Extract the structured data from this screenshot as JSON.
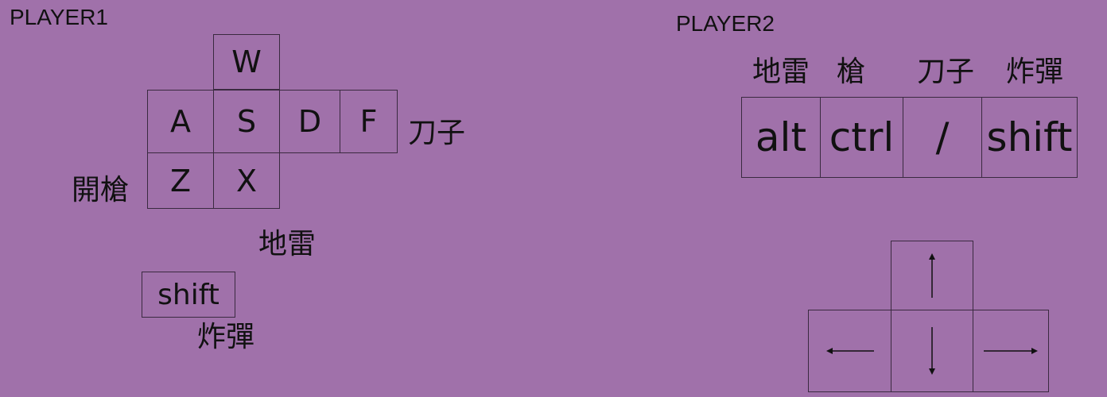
{
  "player1": {
    "title": "PLAYER1",
    "keys": {
      "up": "W",
      "left": "A",
      "down": "S",
      "right": "D",
      "fire2": "F",
      "fire": "Z",
      "mine": "X",
      "bomb": "shift"
    },
    "labels": {
      "knife": "刀子",
      "shoot": "開槍",
      "mine": "地雷",
      "bomb": "炸彈"
    }
  },
  "player2": {
    "title": "PLAYER2",
    "keys": {
      "mine": "alt",
      "shoot": "ctrl",
      "knife": "/",
      "bomb": "shift"
    },
    "labels": {
      "mine": "地雷",
      "shoot": "槍",
      "knife": "刀子",
      "bomb": "炸彈"
    },
    "arrows": [
      "arrow-up-icon",
      "arrow-left-icon",
      "arrow-down-icon",
      "arrow-right-icon"
    ]
  },
  "colors": {
    "background": "#a071aa",
    "border": "#3a2a40"
  }
}
